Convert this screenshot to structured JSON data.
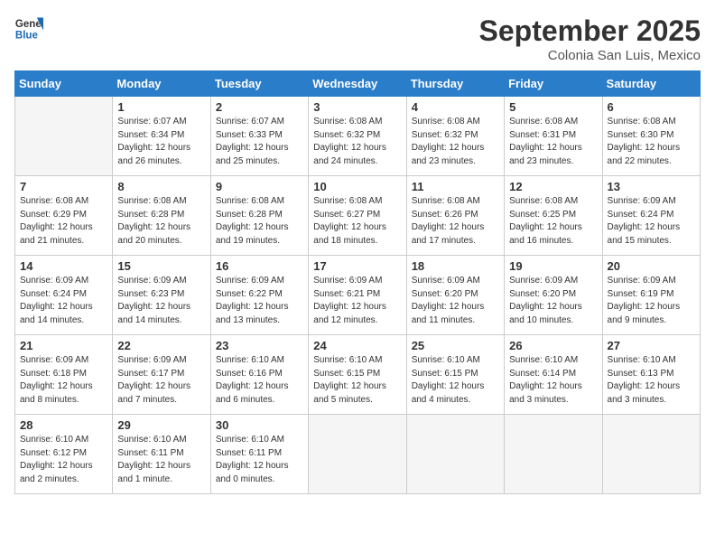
{
  "logo": {
    "line1": "General",
    "line2": "Blue"
  },
  "title": "September 2025",
  "location": "Colonia San Luis, Mexico",
  "days_of_week": [
    "Sunday",
    "Monday",
    "Tuesday",
    "Wednesday",
    "Thursday",
    "Friday",
    "Saturday"
  ],
  "weeks": [
    [
      {
        "day": "",
        "sunrise": "",
        "sunset": "",
        "daylight": ""
      },
      {
        "day": "1",
        "sunrise": "Sunrise: 6:07 AM",
        "sunset": "Sunset: 6:34 PM",
        "daylight": "Daylight: 12 hours and 26 minutes."
      },
      {
        "day": "2",
        "sunrise": "Sunrise: 6:07 AM",
        "sunset": "Sunset: 6:33 PM",
        "daylight": "Daylight: 12 hours and 25 minutes."
      },
      {
        "day": "3",
        "sunrise": "Sunrise: 6:08 AM",
        "sunset": "Sunset: 6:32 PM",
        "daylight": "Daylight: 12 hours and 24 minutes."
      },
      {
        "day": "4",
        "sunrise": "Sunrise: 6:08 AM",
        "sunset": "Sunset: 6:32 PM",
        "daylight": "Daylight: 12 hours and 23 minutes."
      },
      {
        "day": "5",
        "sunrise": "Sunrise: 6:08 AM",
        "sunset": "Sunset: 6:31 PM",
        "daylight": "Daylight: 12 hours and 23 minutes."
      },
      {
        "day": "6",
        "sunrise": "Sunrise: 6:08 AM",
        "sunset": "Sunset: 6:30 PM",
        "daylight": "Daylight: 12 hours and 22 minutes."
      }
    ],
    [
      {
        "day": "7",
        "sunrise": "Sunrise: 6:08 AM",
        "sunset": "Sunset: 6:29 PM",
        "daylight": "Daylight: 12 hours and 21 minutes."
      },
      {
        "day": "8",
        "sunrise": "Sunrise: 6:08 AM",
        "sunset": "Sunset: 6:28 PM",
        "daylight": "Daylight: 12 hours and 20 minutes."
      },
      {
        "day": "9",
        "sunrise": "Sunrise: 6:08 AM",
        "sunset": "Sunset: 6:28 PM",
        "daylight": "Daylight: 12 hours and 19 minutes."
      },
      {
        "day": "10",
        "sunrise": "Sunrise: 6:08 AM",
        "sunset": "Sunset: 6:27 PM",
        "daylight": "Daylight: 12 hours and 18 minutes."
      },
      {
        "day": "11",
        "sunrise": "Sunrise: 6:08 AM",
        "sunset": "Sunset: 6:26 PM",
        "daylight": "Daylight: 12 hours and 17 minutes."
      },
      {
        "day": "12",
        "sunrise": "Sunrise: 6:08 AM",
        "sunset": "Sunset: 6:25 PM",
        "daylight": "Daylight: 12 hours and 16 minutes."
      },
      {
        "day": "13",
        "sunrise": "Sunrise: 6:09 AM",
        "sunset": "Sunset: 6:24 PM",
        "daylight": "Daylight: 12 hours and 15 minutes."
      }
    ],
    [
      {
        "day": "14",
        "sunrise": "Sunrise: 6:09 AM",
        "sunset": "Sunset: 6:24 PM",
        "daylight": "Daylight: 12 hours and 14 minutes."
      },
      {
        "day": "15",
        "sunrise": "Sunrise: 6:09 AM",
        "sunset": "Sunset: 6:23 PM",
        "daylight": "Daylight: 12 hours and 14 minutes."
      },
      {
        "day": "16",
        "sunrise": "Sunrise: 6:09 AM",
        "sunset": "Sunset: 6:22 PM",
        "daylight": "Daylight: 12 hours and 13 minutes."
      },
      {
        "day": "17",
        "sunrise": "Sunrise: 6:09 AM",
        "sunset": "Sunset: 6:21 PM",
        "daylight": "Daylight: 12 hours and 12 minutes."
      },
      {
        "day": "18",
        "sunrise": "Sunrise: 6:09 AM",
        "sunset": "Sunset: 6:20 PM",
        "daylight": "Daylight: 12 hours and 11 minutes."
      },
      {
        "day": "19",
        "sunrise": "Sunrise: 6:09 AM",
        "sunset": "Sunset: 6:20 PM",
        "daylight": "Daylight: 12 hours and 10 minutes."
      },
      {
        "day": "20",
        "sunrise": "Sunrise: 6:09 AM",
        "sunset": "Sunset: 6:19 PM",
        "daylight": "Daylight: 12 hours and 9 minutes."
      }
    ],
    [
      {
        "day": "21",
        "sunrise": "Sunrise: 6:09 AM",
        "sunset": "Sunset: 6:18 PM",
        "daylight": "Daylight: 12 hours and 8 minutes."
      },
      {
        "day": "22",
        "sunrise": "Sunrise: 6:09 AM",
        "sunset": "Sunset: 6:17 PM",
        "daylight": "Daylight: 12 hours and 7 minutes."
      },
      {
        "day": "23",
        "sunrise": "Sunrise: 6:10 AM",
        "sunset": "Sunset: 6:16 PM",
        "daylight": "Daylight: 12 hours and 6 minutes."
      },
      {
        "day": "24",
        "sunrise": "Sunrise: 6:10 AM",
        "sunset": "Sunset: 6:15 PM",
        "daylight": "Daylight: 12 hours and 5 minutes."
      },
      {
        "day": "25",
        "sunrise": "Sunrise: 6:10 AM",
        "sunset": "Sunset: 6:15 PM",
        "daylight": "Daylight: 12 hours and 4 minutes."
      },
      {
        "day": "26",
        "sunrise": "Sunrise: 6:10 AM",
        "sunset": "Sunset: 6:14 PM",
        "daylight": "Daylight: 12 hours and 3 minutes."
      },
      {
        "day": "27",
        "sunrise": "Sunrise: 6:10 AM",
        "sunset": "Sunset: 6:13 PM",
        "daylight": "Daylight: 12 hours and 3 minutes."
      }
    ],
    [
      {
        "day": "28",
        "sunrise": "Sunrise: 6:10 AM",
        "sunset": "Sunset: 6:12 PM",
        "daylight": "Daylight: 12 hours and 2 minutes."
      },
      {
        "day": "29",
        "sunrise": "Sunrise: 6:10 AM",
        "sunset": "Sunset: 6:11 PM",
        "daylight": "Daylight: 12 hours and 1 minute."
      },
      {
        "day": "30",
        "sunrise": "Sunrise: 6:10 AM",
        "sunset": "Sunset: 6:11 PM",
        "daylight": "Daylight: 12 hours and 0 minutes."
      },
      {
        "day": "",
        "sunrise": "",
        "sunset": "",
        "daylight": ""
      },
      {
        "day": "",
        "sunrise": "",
        "sunset": "",
        "daylight": ""
      },
      {
        "day": "",
        "sunrise": "",
        "sunset": "",
        "daylight": ""
      },
      {
        "day": "",
        "sunrise": "",
        "sunset": "",
        "daylight": ""
      }
    ]
  ]
}
